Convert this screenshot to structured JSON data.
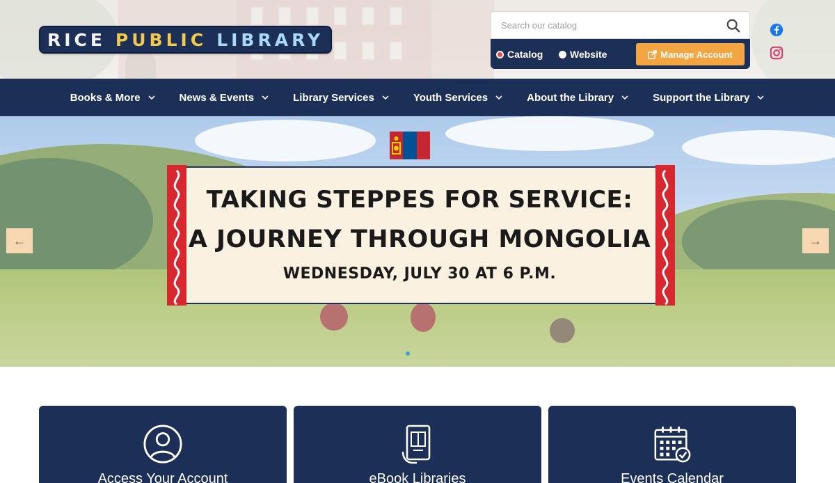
{
  "header": {
    "logo": {
      "words": [
        {
          "text": "RICE",
          "color": "#f4f4f4"
        },
        {
          "text": "PUBLIC",
          "color": "#f2c94c"
        },
        {
          "text": "LIBRARY",
          "color": "#a9d9f5"
        }
      ]
    },
    "search": {
      "placeholder": "Search our catalog",
      "value": "",
      "scope_options": [
        "Catalog",
        "Website"
      ],
      "selected_scope": "Catalog"
    },
    "manage_account_label": "Manage Account",
    "social": [
      "facebook-icon",
      "instagram-icon"
    ]
  },
  "nav": {
    "items": [
      {
        "label": "Books & More"
      },
      {
        "label": "News & Events"
      },
      {
        "label": "Library Services"
      },
      {
        "label": "Youth Services"
      },
      {
        "label": "About the Library"
      },
      {
        "label": "Support the Library"
      }
    ]
  },
  "hero": {
    "line1": "TAKING STEPPES FOR SERVICE:",
    "line2": "A JOURNEY THROUGH MONGOLIA",
    "line3": "WEDNESDAY, JULY 30 AT 6 P.M.",
    "prev_label": "←",
    "next_label": "→"
  },
  "quick_links": [
    {
      "label": "Access Your Account",
      "icon": "user-circle-icon"
    },
    {
      "label": "eBook Libraries",
      "icon": "tablet-book-icon"
    },
    {
      "label": "Events Calendar",
      "icon": "calendar-check-icon"
    }
  ],
  "colors": {
    "navy": "#1c2f57",
    "accent_orange": "#f2a541",
    "banner_red": "#d7272f",
    "banner_cream": "#fbf1e1"
  }
}
